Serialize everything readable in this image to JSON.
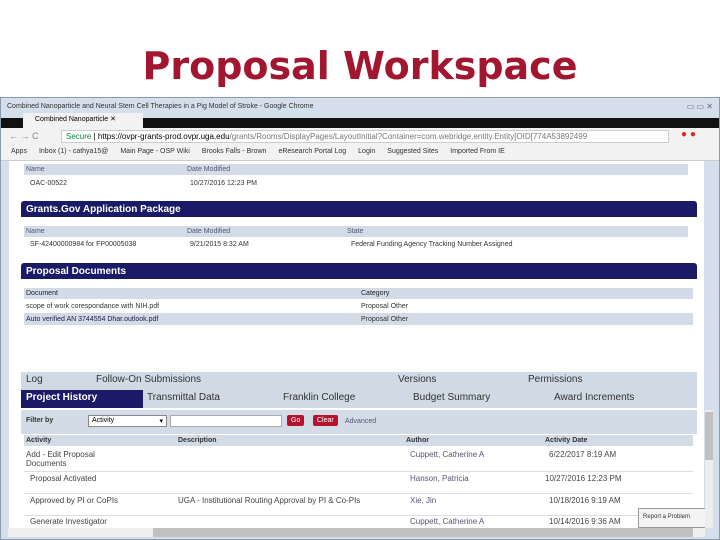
{
  "slide_title": "Proposal Workspace",
  "browser": {
    "window_title": "Combined Nanoparticle and Neural Stem Cell Therapies in a Pig Model of Stroke - Google Chrome",
    "tab_label": "Combined Nanoparticle",
    "secure_label": "Secure",
    "url_host": "https://ovpr-grants-prod.ovpr.uga.edu",
    "url_path": "/grants/Rooms/DisplayPages/LayoutInitial?Container=com.webridge.entity.Entity[OID[774A53892499",
    "bookmarks": [
      "Apps",
      "Inbox (1) - cathya15@",
      "Main Page - OSP Wiki",
      "Brooks Falls - Brown",
      "eResearch Portal Log",
      "Login",
      "Suggested Sites",
      "Imported From IE"
    ]
  },
  "oac": {
    "headers": [
      "Name",
      "Date Modified"
    ],
    "row": [
      "OAC-00522",
      "10/27/2016 12:23 PM"
    ]
  },
  "grants_gov": {
    "title": "Grants.Gov Application Package",
    "headers": [
      "Name",
      "Date Modified",
      "State"
    ],
    "row": [
      "SF-42400000984 for FP00005038",
      "9/21/2015 8:32 AM",
      "Federal Funding Agency Tracking Number Assigned"
    ]
  },
  "documents": {
    "title": "Proposal Documents",
    "headers": [
      "Document",
      "Category"
    ],
    "rows": [
      [
        "scope of work corespondance with NIH.pdf",
        "Proposal Other"
      ],
      [
        "Auto verified AN 3744554 Dhar.outlook.pdf",
        "Proposal Other"
      ]
    ]
  },
  "tabs_row1": [
    "Log",
    "Follow-On Submissions",
    "Versions",
    "Permissions"
  ],
  "tabs_row2": [
    "Project History",
    "Transmittal Data",
    "Franklin College",
    "Budget Summary",
    "Award Increments"
  ],
  "filter": {
    "label": "Filter by",
    "select": "Activity",
    "value": "",
    "go": "Go",
    "clear": "Clear",
    "advanced": "Advanced"
  },
  "history": {
    "headers": [
      "Activity",
      "Description",
      "Author",
      "Activity Date"
    ],
    "rows": [
      [
        "Add - Edit Proposal Documents",
        "",
        "Cuppett, Catherine A",
        "6/22/2017 8:19 AM"
      ],
      [
        "Proposal Activated",
        "",
        "Hanson, Patricia",
        "10/27/2016 12:23 PM"
      ],
      [
        "Approved by PI or CoPIs",
        "UGA - Institutional Routing Approval by PI & Co-PIs",
        "Xie, Jin",
        "10/18/2016 9:19 AM"
      ],
      [
        "Generate Investigator",
        "",
        "Cuppett, Catherine A",
        "10/14/2016 9:36 AM"
      ]
    ]
  },
  "report_problem": "Report a Problem",
  "colors": {
    "title": "#a3162f",
    "section_bar": "#1a1a66",
    "button": "#b3132d"
  }
}
